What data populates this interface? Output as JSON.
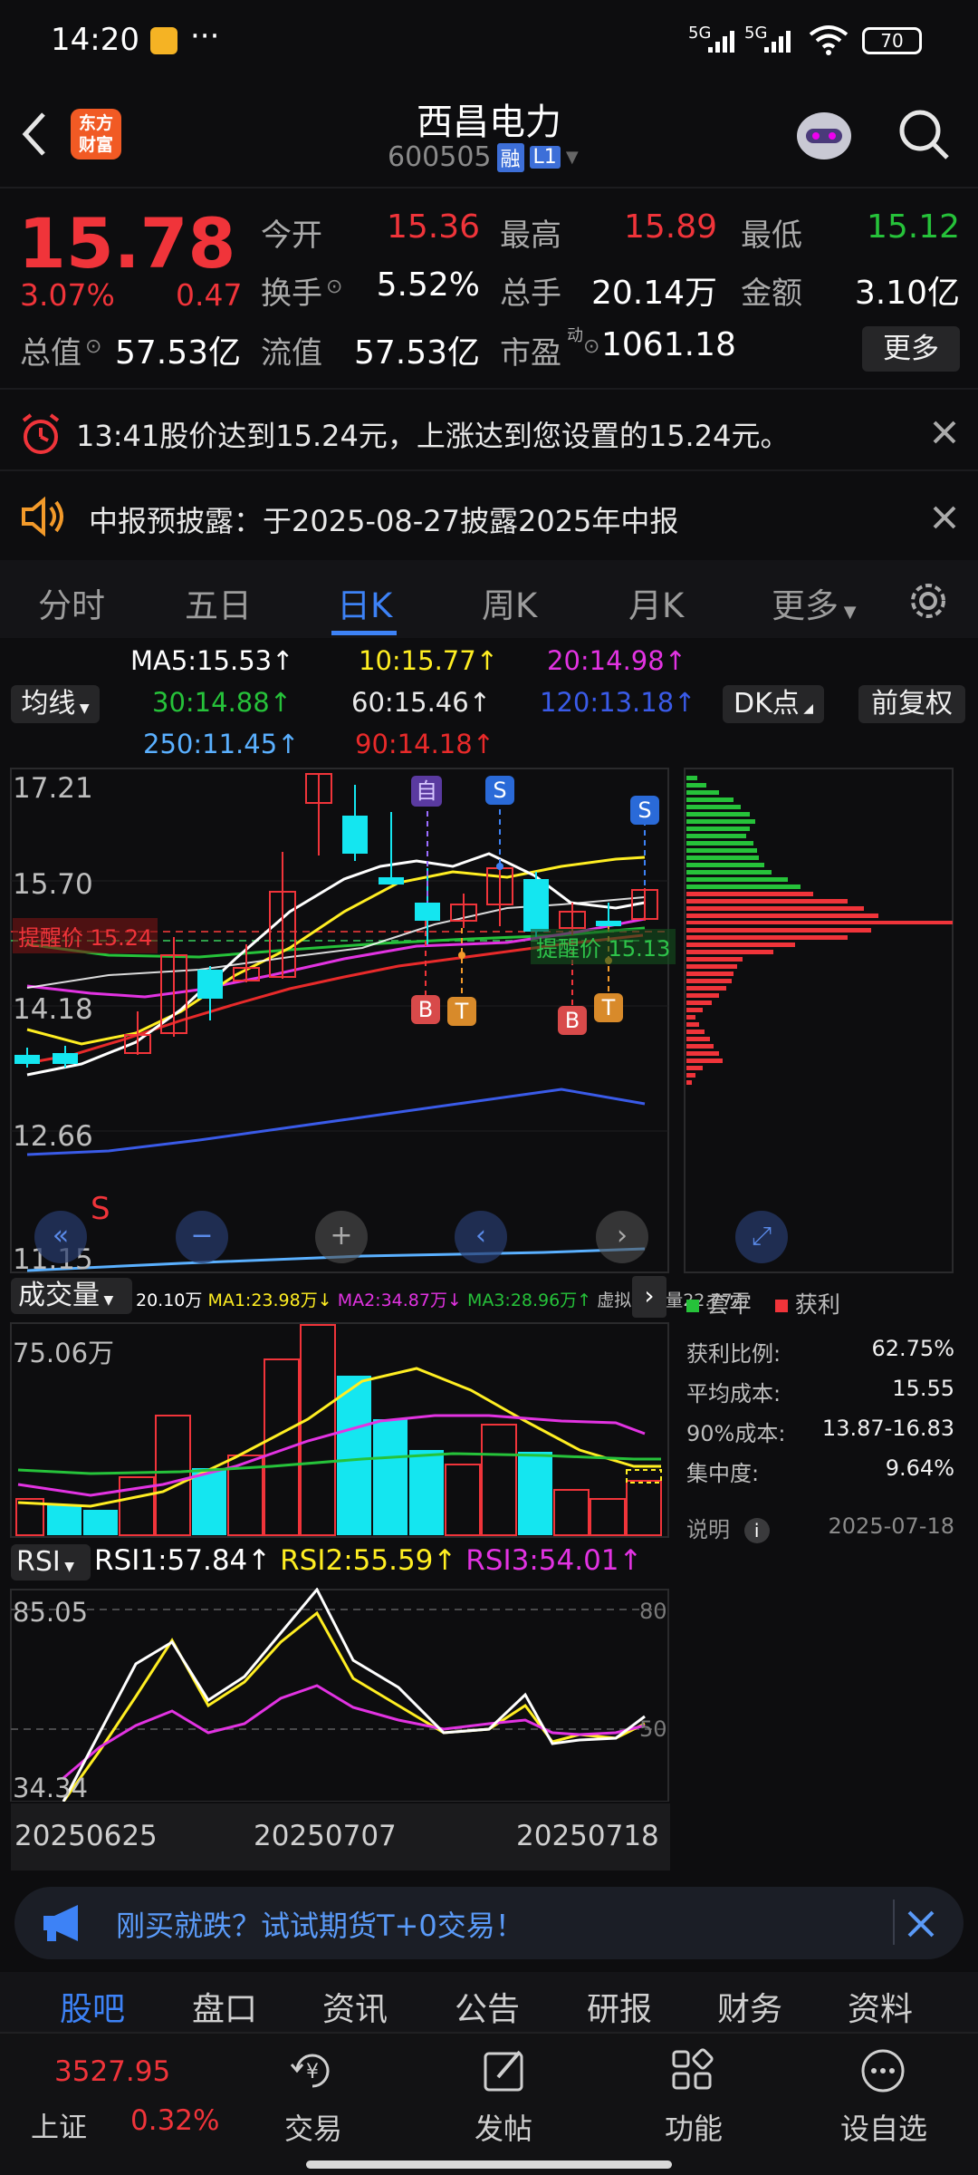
{
  "status_bar": {
    "time": "14:20",
    "dots": "···",
    "signal1": "5G",
    "signal2": "5G",
    "battery": "70"
  },
  "header": {
    "logo_text": "东方财富",
    "stock_name": "西昌电力",
    "stock_code": "600505",
    "badge_rong": "融",
    "badge_level": "L1"
  },
  "quote": {
    "price": "15.78",
    "change_pct": "3.07%",
    "change_amt": "0.47",
    "fields": [
      {
        "label": "今开",
        "value": "15.36",
        "color": "red"
      },
      {
        "label": "最高",
        "value": "15.89",
        "color": "red"
      },
      {
        "label": "最低",
        "value": "15.12",
        "color": "green"
      },
      {
        "label": "换手",
        "value": "5.52%",
        "color": "white"
      },
      {
        "label": "总手",
        "value": "20.14万",
        "color": "white"
      },
      {
        "label": "金额",
        "value": "3.10亿",
        "color": "white"
      },
      {
        "label": "总值",
        "value": "57.53亿",
        "color": "white"
      },
      {
        "label": "流值",
        "value": "57.53亿",
        "color": "white"
      },
      {
        "label": "市盈",
        "value": "1061.18",
        "color": "white"
      }
    ],
    "pe_sup": "动",
    "more_label": "更多"
  },
  "alert_banner": {
    "text": "13:41股价达到15.24元，上涨达到您设置的15.24元。"
  },
  "notice_banner": {
    "text": "中报预披露：于2025-08-27披露2025年中报"
  },
  "tabs": [
    "分时",
    "五日",
    "日K",
    "周K",
    "月K",
    "更多"
  ],
  "active_tab": "日K",
  "ma_labels": {
    "ma5": "MA5:15.53",
    "ma10": "10:15.77",
    "ma20": "20:14.98",
    "ma30": "30:14.88",
    "ma60": "60:15.46",
    "ma120": "120:13.18",
    "ma250": "250:11.45",
    "ma90": "90:14.18",
    "arrow": "↑"
  },
  "controls": {
    "ma_select": "均线",
    "dk_select": "DK点",
    "adjust": "前复权"
  },
  "kline": {
    "yaxis": [
      "17.21",
      "15.70",
      "14.18",
      "12.66",
      "11.15"
    ],
    "alert_left": "提醒价 15.24",
    "alert_right": "提醒价 15.13",
    "marker_self": "自",
    "marker_s": "S",
    "marker_b": "B",
    "marker_t": "T",
    "bottom_s": "S"
  },
  "volume": {
    "select": "成交量",
    "legend": [
      "20.10万",
      "MA1:23.98万↓",
      "MA2:34.87万↓",
      "MA3:28.96万↑",
      "虚拟成交量22.77万"
    ],
    "max_label": "75.06万"
  },
  "rsi": {
    "select": "RSI",
    "rsi1": "RSI1:57.84",
    "rsi2": "RSI2:55.59",
    "rsi3": "RSI3:54.01",
    "arrow": "↑",
    "ytop": "85.05",
    "ybottom": "34.34",
    "ref80": "80",
    "ref50": "50",
    "dates": [
      "20250625",
      "20250707",
      "20250718"
    ]
  },
  "chip_panel": {
    "legend_trapped": "套牢",
    "legend_profit": "获利",
    "rows": [
      {
        "label": "获利比例:",
        "value": "62.75%"
      },
      {
        "label": "平均成本:",
        "value": "15.55"
      },
      {
        "label": "90%成本:",
        "value": "13.87-16.83"
      },
      {
        "label": "集中度:",
        "value": "9.64%"
      }
    ],
    "note_label": "说明",
    "note_date": "2025-07-18"
  },
  "promo": {
    "text": "刚买就跌？试试期货T+0交易！"
  },
  "bottom_tabs": [
    "股吧",
    "盘口",
    "资讯",
    "公告",
    "研报",
    "财务",
    "资料"
  ],
  "nav": {
    "index_value": "3527.95",
    "index_name": "上证",
    "index_change": "0.32%",
    "items": [
      "交易",
      "发帖",
      "功能",
      "设自选"
    ]
  },
  "colors": {
    "up": "#f0343a",
    "down": "#26c23a",
    "accent": "#3d82f6",
    "candle_down": "#14e6f0"
  }
}
